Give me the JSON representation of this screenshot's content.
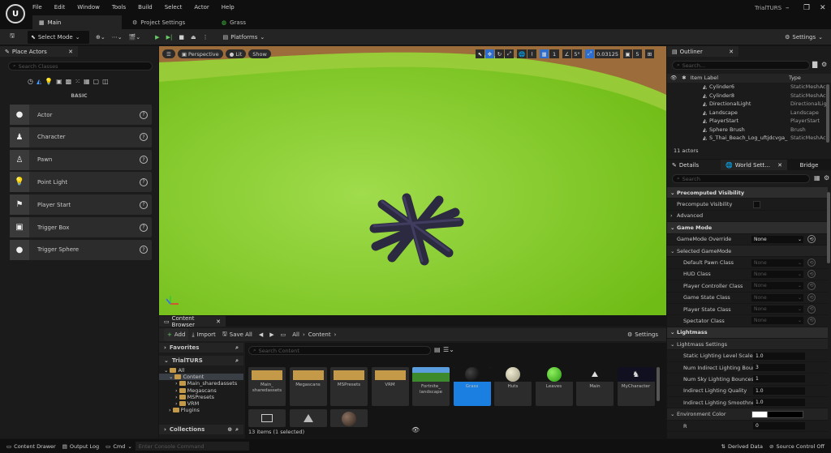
{
  "menu": [
    "File",
    "Edit",
    "Window",
    "Tools",
    "Build",
    "Select",
    "Actor",
    "Help"
  ],
  "tabs": {
    "main": "Main",
    "project_settings": "Project Settings",
    "grass": "Grass"
  },
  "project_name": "TrialTURS",
  "toolbar": {
    "select_mode": "Select Mode",
    "platforms": "Platforms",
    "settings": "Settings"
  },
  "place_actors": {
    "title": "Place Actors",
    "search_placeholder": "Search Classes",
    "category": "BASIC",
    "items": [
      {
        "label": "Actor",
        "icon": "sphere-icon"
      },
      {
        "label": "Character",
        "icon": "character-icon"
      },
      {
        "label": "Pawn",
        "icon": "pawn-icon"
      },
      {
        "label": "Point Light",
        "icon": "lightbulb-icon"
      },
      {
        "label": "Player Start",
        "icon": "flag-icon"
      },
      {
        "label": "Trigger Box",
        "icon": "cube-icon"
      },
      {
        "label": "Trigger Sphere",
        "icon": "sphere-icon"
      }
    ]
  },
  "viewport": {
    "perspective": "Perspective",
    "lit": "Lit",
    "show": "Show",
    "grid": "1",
    "angle": "5°",
    "scale": "0.03125",
    "camera_speed": "5",
    "bg_color": "#7bc425"
  },
  "outliner": {
    "title": "Outliner",
    "search_placeholder": "Search...",
    "col_label": "Item Label",
    "col_type": "Type",
    "rows": [
      {
        "label": "Cylinder6",
        "type": "StaticMeshAc"
      },
      {
        "label": "Cylinder8",
        "type": "StaticMeshAc"
      },
      {
        "label": "DirectionalLight",
        "type": "DirectionalLig"
      },
      {
        "label": "Landscape",
        "type": "Landscape"
      },
      {
        "label": "PlayerStart",
        "type": "PlayerStart"
      },
      {
        "label": "Sphere Brush",
        "type": "Brush"
      },
      {
        "label": "S_Thai_Beach_Log_uftjdcvga_",
        "type": "StaticMeshAc"
      }
    ],
    "count": "11 actors"
  },
  "details": {
    "tab_details": "Details",
    "tab_world": "World Sett...",
    "tab_bridge": "Bridge",
    "search_placeholder": "Search",
    "rows": [
      {
        "kind": "section",
        "label": "Precomputed Visibility"
      },
      {
        "kind": "prop",
        "label": "Precompute Visibility",
        "value": "",
        "control": "check"
      },
      {
        "kind": "collapsed",
        "label": "Advanced"
      },
      {
        "kind": "section",
        "label": "Game Mode"
      },
      {
        "kind": "prop",
        "label": "GameMode Override",
        "value": "None",
        "control": "dd-active"
      },
      {
        "kind": "subsection",
        "label": "Selected GameMode"
      },
      {
        "kind": "subprop",
        "label": "Default Pawn Class",
        "value": "None",
        "control": "dd"
      },
      {
        "kind": "subprop",
        "label": "HUD Class",
        "value": "None",
        "control": "dd"
      },
      {
        "kind": "subprop",
        "label": "Player Controller Class",
        "value": "None",
        "control": "dd"
      },
      {
        "kind": "subprop",
        "label": "Game State Class",
        "value": "None",
        "control": "dd"
      },
      {
        "kind": "subprop",
        "label": "Player State Class",
        "value": "None",
        "control": "dd"
      },
      {
        "kind": "subprop",
        "label": "Spectator Class",
        "value": "None",
        "control": "dd"
      },
      {
        "kind": "section",
        "label": "Lightmass"
      },
      {
        "kind": "subsection",
        "label": "Lightmass Settings"
      },
      {
        "kind": "subprop",
        "label": "Static Lighting Level Scale",
        "value": "1.0",
        "control": "field"
      },
      {
        "kind": "subprop",
        "label": "Num Indirect Lighting Boun...",
        "value": "3",
        "control": "field"
      },
      {
        "kind": "subprop",
        "label": "Num Sky Lighting Bounces",
        "value": "1",
        "control": "field"
      },
      {
        "kind": "subprop",
        "label": "Indirect Lighting Quality",
        "value": "1.0",
        "control": "field"
      },
      {
        "kind": "subprop",
        "label": "Indirect Lighting Smoothne...",
        "value": "1.0",
        "control": "field"
      },
      {
        "kind": "subsection",
        "label": "Environment Color",
        "value": "",
        "control": "color"
      },
      {
        "kind": "subprop",
        "label": "R",
        "value": "0",
        "control": "field"
      }
    ]
  },
  "content_browser": {
    "title": "Content Browser",
    "add": "Add",
    "import": "Import",
    "save_all": "Save All",
    "breadcrumb": [
      "All",
      "Content"
    ],
    "settings": "Settings",
    "favorites": "Favorites",
    "project": "TrialTURS",
    "tree": [
      "All",
      "Content",
      "Main_sharedassets",
      "Megascans",
      "MSPresets",
      "VRM",
      "Plugins"
    ],
    "collections": "Collections",
    "search_placeholder": "Search Content",
    "assets": [
      {
        "name": "Main_\nsharedassets",
        "kind": "folder"
      },
      {
        "name": "Megascans",
        "kind": "folder"
      },
      {
        "name": "MSPresets",
        "kind": "folder"
      },
      {
        "name": "VRM",
        "kind": "folder"
      },
      {
        "name": "Fortnite_\nlandscape",
        "kind": "map"
      },
      {
        "name": "Grass",
        "kind": "mat-black"
      },
      {
        "name": "Huts",
        "kind": "mat-white"
      },
      {
        "name": "Leaves",
        "kind": "mat-green"
      },
      {
        "name": "Main",
        "kind": "map-icon"
      },
      {
        "name": "MyCharacter",
        "kind": "map-icon2"
      }
    ],
    "status": "13 items (1 selected)"
  },
  "statusbar": {
    "content_drawer": "Content Drawer",
    "output_log": "Output Log",
    "cmd": "Cmd",
    "console_placeholder": "Enter Console Command",
    "derived_data": "Derived Data",
    "source_control": "Source Control Off"
  }
}
